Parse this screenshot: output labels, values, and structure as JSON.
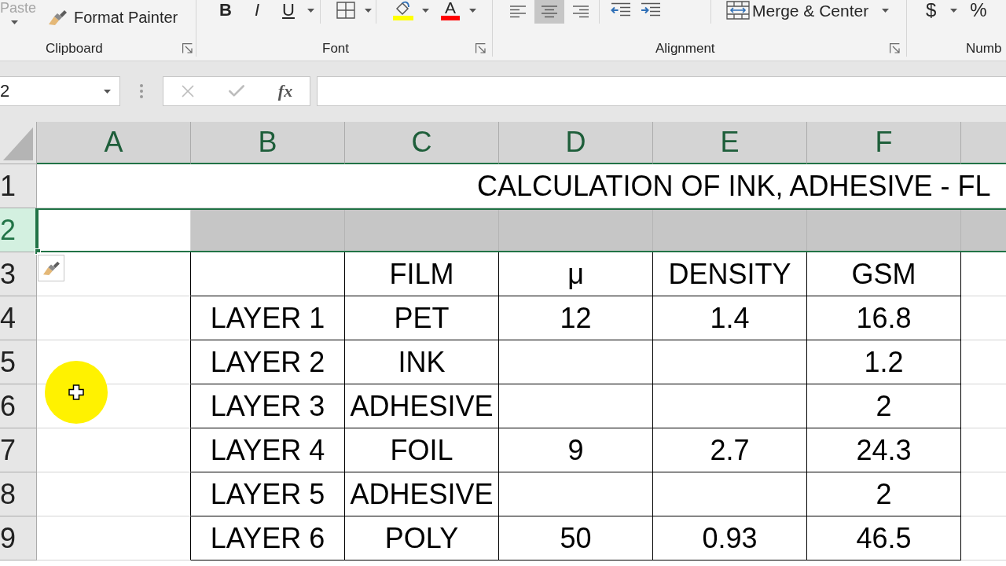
{
  "ribbon": {
    "clipboard": {
      "paste": {
        "label": "Paste",
        "disabled": true
      },
      "format_painter": "Format Painter",
      "label": "Clipboard"
    },
    "font": {
      "bold": "B",
      "italic": "I",
      "underline": "U",
      "font_color": "A",
      "label": "Font"
    },
    "alignment": {
      "align_buttons": [
        {
          "kind": "left",
          "selected": false
        },
        {
          "kind": "center",
          "selected": true
        },
        {
          "kind": "right",
          "selected": false
        }
      ],
      "merge": "Merge & Center",
      "label": "Alignment"
    },
    "number": {
      "currency": "$",
      "percent": "%",
      "label": "Numb"
    }
  },
  "formula_bar": {
    "name_box": "2",
    "function_button": "fx"
  },
  "columns": [
    {
      "letter": "A",
      "selected": true
    },
    {
      "letter": "B",
      "selected": true
    },
    {
      "letter": "C",
      "selected": true
    },
    {
      "letter": "D",
      "selected": true
    },
    {
      "letter": "E",
      "selected": true
    },
    {
      "letter": "F",
      "selected": true
    }
  ],
  "rows": [
    {
      "number": "1",
      "selected": false,
      "kind": "title",
      "text": "CALCULATION OF INK, ADHESIVE - FL"
    },
    {
      "number": "2",
      "selected": true,
      "kind": "blank"
    },
    {
      "number": "3",
      "selected": false,
      "kind": "table_header",
      "cells": {
        "film": "FILM",
        "micron": "μ",
        "density": "DENSITY",
        "gsm": "GSM"
      }
    },
    {
      "number": "4",
      "selected": false,
      "kind": "table_row",
      "cells": {
        "layer": "LAYER 1",
        "film": "PET",
        "micron": "12",
        "density": "1.4",
        "gsm": "16.8"
      }
    },
    {
      "number": "5",
      "selected": false,
      "kind": "table_row",
      "cells": {
        "layer": "LAYER 2",
        "film": "INK",
        "gsm": "1.2"
      }
    },
    {
      "number": "6",
      "selected": false,
      "kind": "table_row",
      "cells": {
        "layer": "LAYER 3",
        "film": "ADHESIVE",
        "gsm": "2"
      }
    },
    {
      "number": "7",
      "selected": false,
      "kind": "table_row",
      "cells": {
        "layer": "LAYER 4",
        "film": "FOIL",
        "micron": "9",
        "density": "2.7",
        "gsm": "24.3"
      }
    },
    {
      "number": "8",
      "selected": false,
      "kind": "table_row",
      "cells": {
        "layer": "LAYER 5",
        "film": "ADHESIVE",
        "gsm": "2"
      }
    },
    {
      "number": "9",
      "selected": false,
      "kind": "table_row",
      "cells": {
        "layer": "LAYER 6",
        "film": "POLY",
        "micron": "50",
        "density": "0.93",
        "gsm": "46.5"
      }
    }
  ]
}
